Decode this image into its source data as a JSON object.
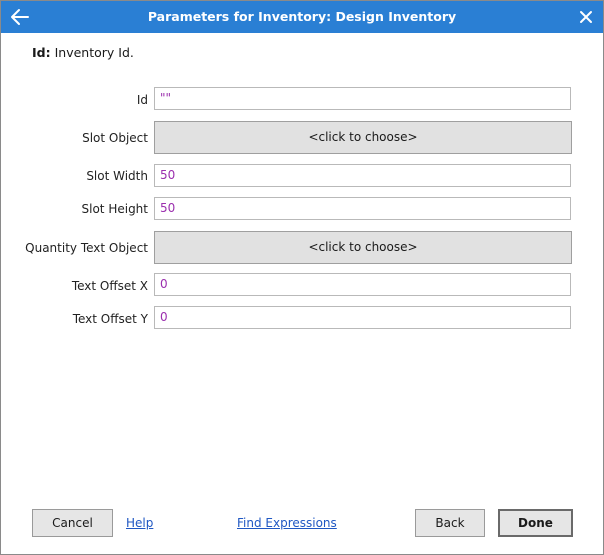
{
  "window": {
    "title": "Parameters for Inventory: Design Inventory",
    "back_icon": "arrow-left-icon",
    "close_icon": "close-icon",
    "titlebar_color": "#2a7fd4"
  },
  "description": {
    "key": "Id:",
    "text": "Inventory Id."
  },
  "params": {
    "id": {
      "label": "Id",
      "value": "\"\""
    },
    "slot_object": {
      "label": "Slot Object",
      "value": "<click to choose>"
    },
    "slot_width": {
      "label": "Slot Width",
      "value": "50"
    },
    "slot_height": {
      "label": "Slot Height",
      "value": "50"
    },
    "quantity_text_object": {
      "label": "Quantity Text Object",
      "value": "<click to choose>"
    },
    "text_offset_x": {
      "label": "Text Offset X",
      "value": "0"
    },
    "text_offset_y": {
      "label": "Text Offset Y",
      "value": "0"
    }
  },
  "footer": {
    "cancel": "Cancel",
    "help": "Help",
    "find_expressions": "Find Expressions",
    "back": "Back",
    "done": "Done"
  },
  "value_color": "#9b2fae",
  "link_color": "#1f57c3"
}
